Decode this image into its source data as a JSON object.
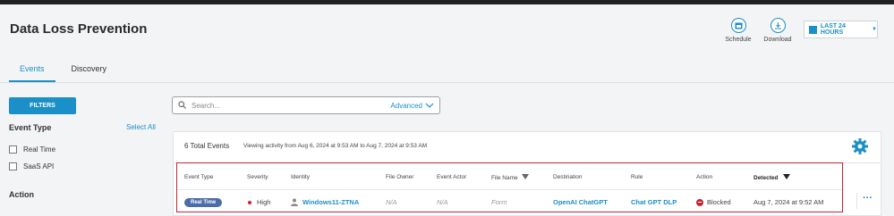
{
  "page": {
    "title": "Data Loss Prevention"
  },
  "tabs": [
    {
      "label": "Events",
      "active": true
    },
    {
      "label": "Discovery",
      "active": false
    }
  ],
  "header_actions": {
    "schedule_label": "Schedule",
    "download_label": "Download",
    "time_range": "LAST 24 HOURS"
  },
  "sidebar": {
    "filters_button": "FILTERS",
    "event_type_heading": "Event Type",
    "select_all": "Select All",
    "options": [
      "Real Time",
      "SaaS API"
    ],
    "action_heading": "Action"
  },
  "search": {
    "placeholder": "Search...",
    "advanced": "Advanced"
  },
  "summary": {
    "total": "6 Total Events",
    "viewing": "Viewing activity from Aug 6, 2024 at 9:53 AM to Aug 7, 2024 at 9:53 AM"
  },
  "table": {
    "columns": [
      "Event Type",
      "Severity",
      "Identity",
      "File Owner",
      "Event Actor",
      "File Name",
      "Destination",
      "Rule",
      "Action",
      "Detected"
    ],
    "rows": [
      {
        "event_type": "Real Time",
        "severity": "High",
        "identity": "Windows11-ZTNA",
        "file_owner": "N/A",
        "event_actor": "N/A",
        "file_name": "Form",
        "destination": "OpenAI ChatGPT",
        "rule": "Chat GPT DLP",
        "action": "Blocked",
        "detected": "Aug 7, 2024 at 9:52 AM"
      }
    ],
    "more_label": "···"
  },
  "colors": {
    "accent": "#1b8fc7",
    "highlight": "#c8242f",
    "badge": "#4a6ca8"
  }
}
